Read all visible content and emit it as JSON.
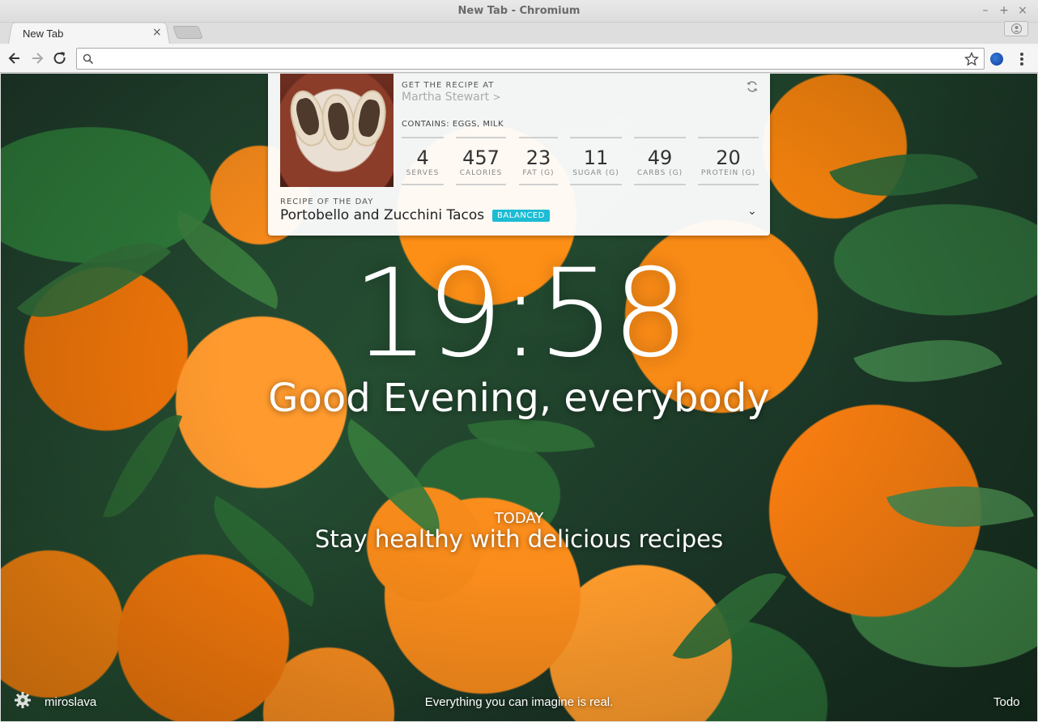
{
  "window": {
    "title": "New Tab - Chromium",
    "controls": {
      "minimize": "–",
      "maximize": "+",
      "close": "×"
    }
  },
  "tab": {
    "title": "New Tab",
    "close_glyph": "×"
  },
  "omnibox": {
    "value": "",
    "placeholder": ""
  },
  "recipe": {
    "get_recipe_label": "GET THE RECIPE AT",
    "source": "Martha Stewart",
    "source_chevron": ">",
    "contains": "CONTAINS: EGGS, MILK",
    "stats": [
      {
        "value": "4",
        "label": "SERVES"
      },
      {
        "value": "457",
        "label": "CALORIES"
      },
      {
        "value": "23",
        "label": "FAT (G)"
      },
      {
        "value": "11",
        "label": "SUGAR (G)"
      },
      {
        "value": "49",
        "label": "CARBS (G)"
      },
      {
        "value": "20",
        "label": "PROTEIN (G)"
      }
    ],
    "section_label": "RECIPE OF THE DAY",
    "name": "Portobello and Zucchini Tacos",
    "badge": "BALANCED",
    "expand_glyph": "⌄",
    "accent_color": "#1bbcd4"
  },
  "clock": "19:58",
  "greeting": "Good Evening, everybody",
  "focus": {
    "label": "TODAY",
    "text": "Stay healthy with delicious recipes"
  },
  "footer": {
    "username": "miroslava",
    "quote": "Everything you can imagine is real.",
    "todo": "Todo"
  },
  "icons": {
    "back": "arrow-left-icon",
    "forward": "arrow-right-icon",
    "reload": "reload-icon",
    "search": "search-icon",
    "bookmark": "star-icon",
    "menu": "kebab-menu-icon",
    "profile": "profile-icon",
    "settings": "gear-icon",
    "refresh": "refresh-icon"
  }
}
